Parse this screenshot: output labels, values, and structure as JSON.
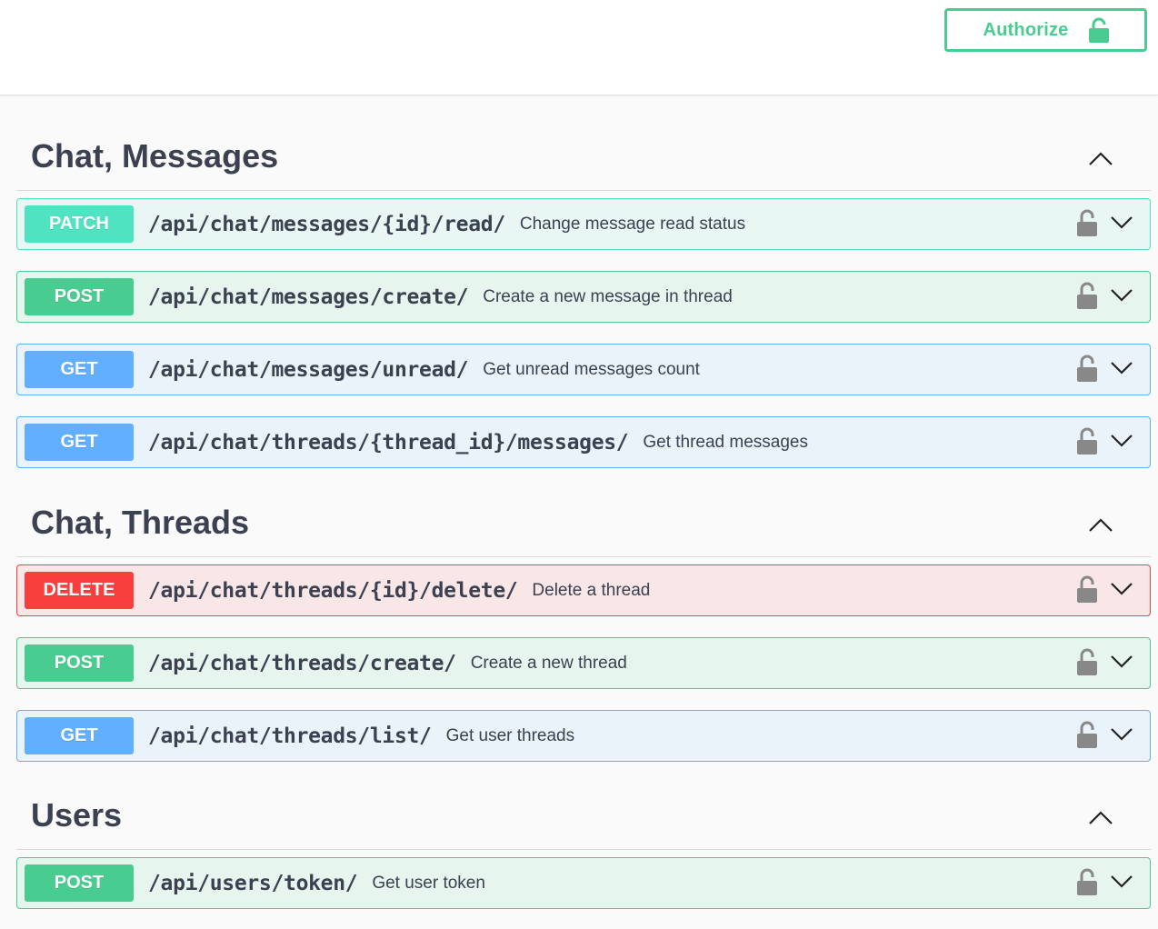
{
  "topbar": {
    "authorize_label": "Authorize",
    "authorize_icon": "lock-icon"
  },
  "colors": {
    "patch": "#50e3c2",
    "post": "#49cc90",
    "get": "#61affe",
    "delete": "#f93e3e",
    "text": "#3b4151"
  },
  "sections": [
    {
      "title": "Chat, Messages",
      "expanded": true,
      "operations": [
        {
          "method": "PATCH",
          "path": "/api/chat/messages/{id}/read/",
          "summary": "Change message read status"
        },
        {
          "method": "POST",
          "path": "/api/chat/messages/create/",
          "summary": "Create a new message in thread"
        },
        {
          "method": "GET",
          "path": "/api/chat/messages/unread/",
          "summary": "Get unread messages count"
        },
        {
          "method": "GET",
          "path": "/api/chat/threads/{thread_id}/messages/",
          "summary": "Get thread messages"
        }
      ]
    },
    {
      "title": "Chat, Threads",
      "expanded": true,
      "operations": [
        {
          "method": "DELETE",
          "path": "/api/chat/threads/{id}/delete/",
          "summary": "Delete a thread"
        },
        {
          "method": "POST",
          "path": "/api/chat/threads/create/",
          "summary": "Create a new thread"
        },
        {
          "method": "GET",
          "path": "/api/chat/threads/list/",
          "summary": "Get user threads"
        }
      ]
    },
    {
      "title": "Users",
      "expanded": true,
      "operations": [
        {
          "method": "POST",
          "path": "/api/users/token/",
          "summary": "Get user token"
        }
      ]
    }
  ]
}
